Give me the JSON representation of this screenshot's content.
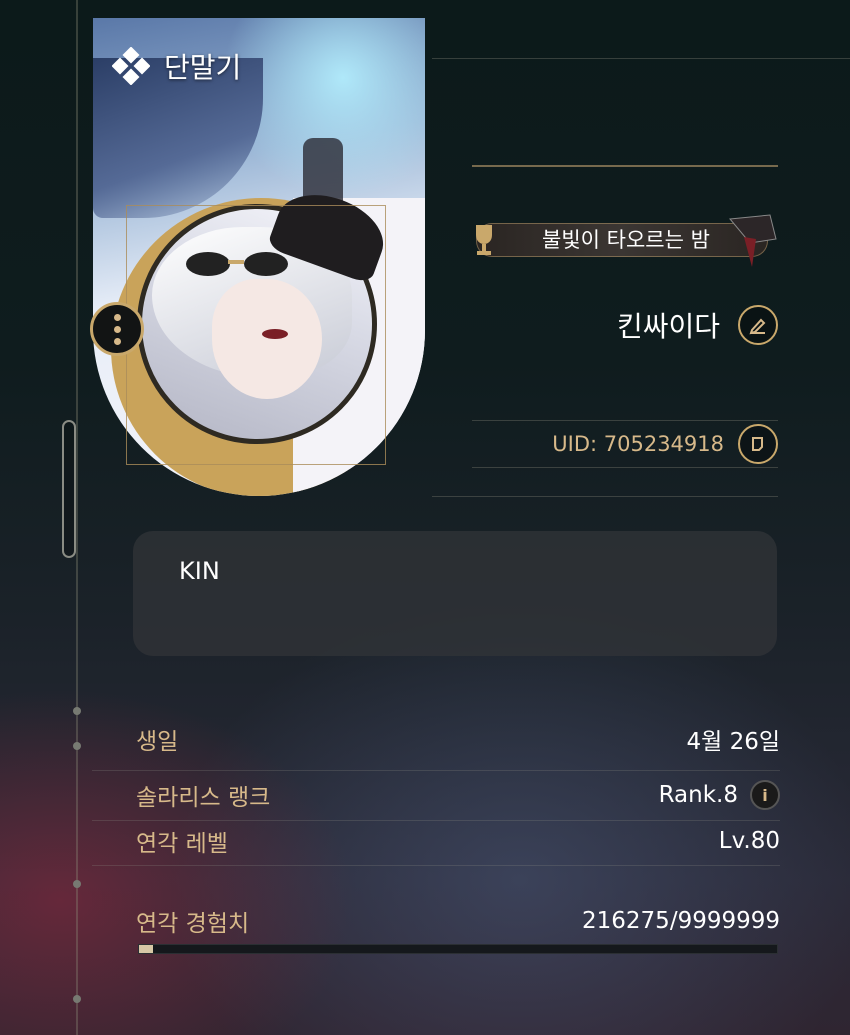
{
  "card": {
    "title": "단말기"
  },
  "title_badge": {
    "label": "불빛이 타오르는 밤"
  },
  "profile": {
    "name": "킨싸이다",
    "uid": "UID: 705234918",
    "signature": "KIN"
  },
  "stats": {
    "birthday": {
      "label": "생일",
      "value": "4월 26일"
    },
    "solaris_rank": {
      "label": "솔라리스 랭크",
      "value": "Rank.8"
    },
    "union_level": {
      "label": "연각 레벨",
      "value": "Lv.80"
    },
    "union_exp": {
      "label": "연각 경험치",
      "value": "216275/9999999",
      "progress": 0.0216
    }
  },
  "icons": {
    "card_logo": "diamond-cluster-icon",
    "menu": "more-vertical-icon",
    "edit": "pencil-icon",
    "copy": "copy-icon",
    "info": "info-icon"
  },
  "colors": {
    "accent_gold": "#d7b98a",
    "frame_gold": "#c9a86b"
  }
}
